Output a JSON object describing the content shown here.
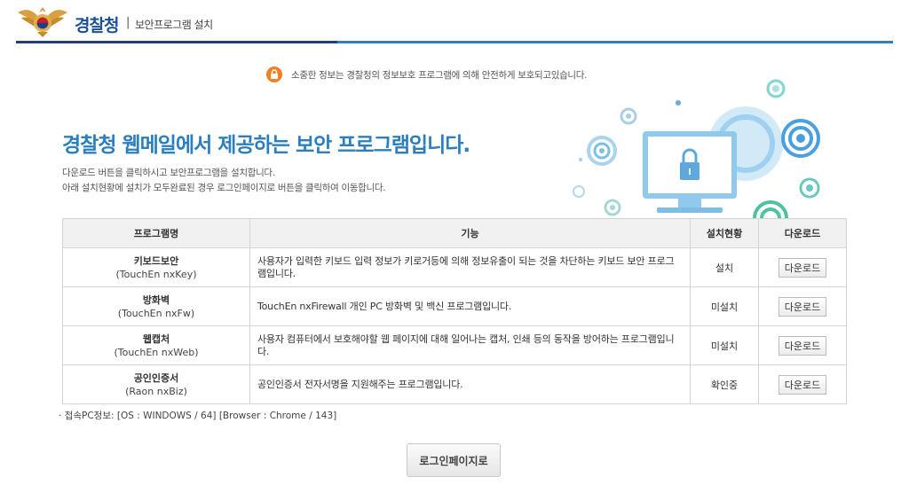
{
  "header": {
    "brand": "경찰청",
    "separator": "|",
    "subtitle": "보안프로그램 설치"
  },
  "notice": {
    "icon": "lock-icon",
    "text": "소중한 정보는 경찰청의 정보보호 프로그램에 의해 안전하게 보호되고있습니다."
  },
  "hero": {
    "title": "경찰청 웹메일에서 제공하는 보안 프로그램입니다.",
    "desc1": "다운로드 버튼을 클릭하시고 보안프로그램을 설치합니다.",
    "desc2": "아래 설치현황에 설치가 모두완료된 경우 로그인페이지로 버튼을 클릭하여 이동합니다."
  },
  "table": {
    "headers": {
      "name": "프로그램명",
      "function": "기능",
      "status": "설치현황",
      "download": "다운로드"
    },
    "rows": [
      {
        "name": "키보드보안",
        "product": "(TouchEn nxKey)",
        "function": "사용자가 입력한 키보드 입력 정보가 키로거등에 의해 정보유출이 되는 것을 차단하는 키보드 보안 프로그램입니다.",
        "status": "설치",
        "download": "다운로드"
      },
      {
        "name": "방화벽",
        "product": "(TouchEn nxFw)",
        "function": "TouchEn nxFirewall 개인 PC 방화벽 및 백신 프로그램입니다.",
        "status": "미설치",
        "download": "다운로드"
      },
      {
        "name": "웹캡처",
        "product": "(TouchEn nxWeb)",
        "function": "사용자 컴퓨터에서 보호해야할 웹 페이지에 대해 일어나는 캡처, 인쇄 등의 동작을 방어하는 프로그램입니다.",
        "status": "미설치",
        "download": "다운로드"
      },
      {
        "name": "공인인증서",
        "product": "(Raon nxBiz)",
        "function": "공인인증서 전자서명을 지원해주는 프로그램입니다.",
        "status": "확인중",
        "download": "다운로드"
      }
    ]
  },
  "pc_info": "· 접속PC정보: [OS : WINDOWS / 64] [Browser : Chrome / 143]",
  "login_button": "로그인페이지로",
  "colors": {
    "accent_blue": "#2b7fbf",
    "brand_navy": "#1b4f9a",
    "notice_orange": "#f08020",
    "illustration_teal": "#5fc8c0"
  }
}
